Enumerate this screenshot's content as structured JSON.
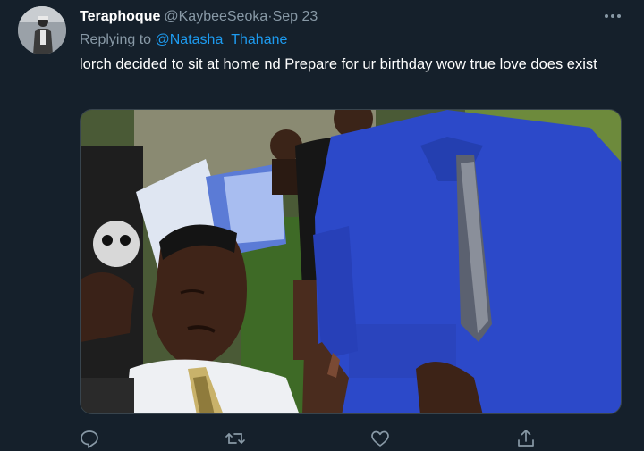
{
  "tweet": {
    "display_name": "Teraphoque",
    "handle": "@KaybeeSeoka",
    "separator": " · ",
    "date": "Sep 23",
    "replying_prefix": "Replying to",
    "replying_to": "@Natasha_Thahane",
    "text": "lorch decided to sit at home nd Prepare for ur birthday wow true love does exist"
  },
  "icons": {
    "more": "more-horizontal-icon",
    "reply": "reply-icon",
    "retweet": "retweet-icon",
    "like": "heart-icon",
    "share": "share-icon"
  },
  "colors": {
    "background": "#15202b",
    "secondary_text": "#8899a6",
    "link": "#1d9bf0",
    "border": "#38444d"
  }
}
